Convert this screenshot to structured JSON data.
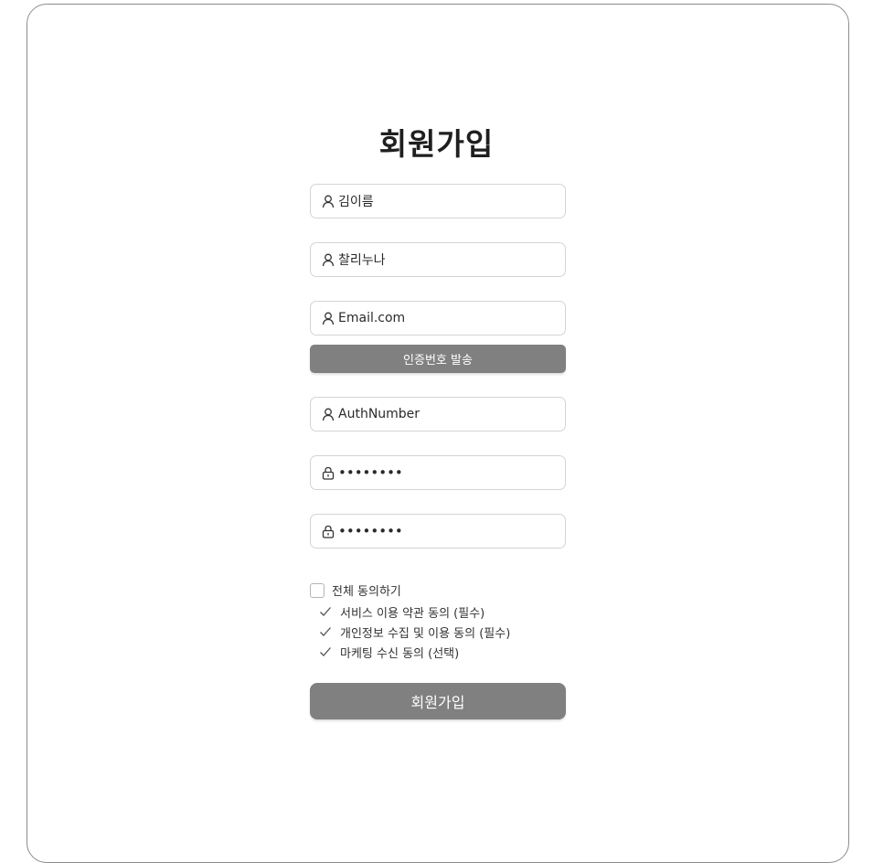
{
  "form": {
    "title": "회원가입",
    "fields": [
      {
        "name": "name",
        "value": "김이름",
        "icon": "user-icon"
      },
      {
        "name": "nickname",
        "value": "찰리누나",
        "icon": "user-icon"
      },
      {
        "name": "email",
        "value": "Email.com",
        "icon": "user-icon"
      },
      {
        "name": "auth-number",
        "value": "AuthNumber",
        "icon": "user-icon"
      },
      {
        "name": "password",
        "value": "••••••••",
        "icon": "lock-icon"
      },
      {
        "name": "password-confirm",
        "value": "••••••••",
        "icon": "lock-icon"
      }
    ],
    "send_code_label": "인증번호 발송",
    "agree_all_label": "전체 동의하기",
    "terms": [
      {
        "label": "서비스 이용 약관 동의 (필수)"
      },
      {
        "label": "개인정보 수집 및 이용 동의 (필수)"
      },
      {
        "label": "마케팅 수신 동의 (선택)"
      }
    ],
    "submit_label": "회원가입"
  },
  "colors": {
    "button_bg": "#808080",
    "border": "#d4d4d4",
    "frame_border": "#8c8c8c"
  }
}
